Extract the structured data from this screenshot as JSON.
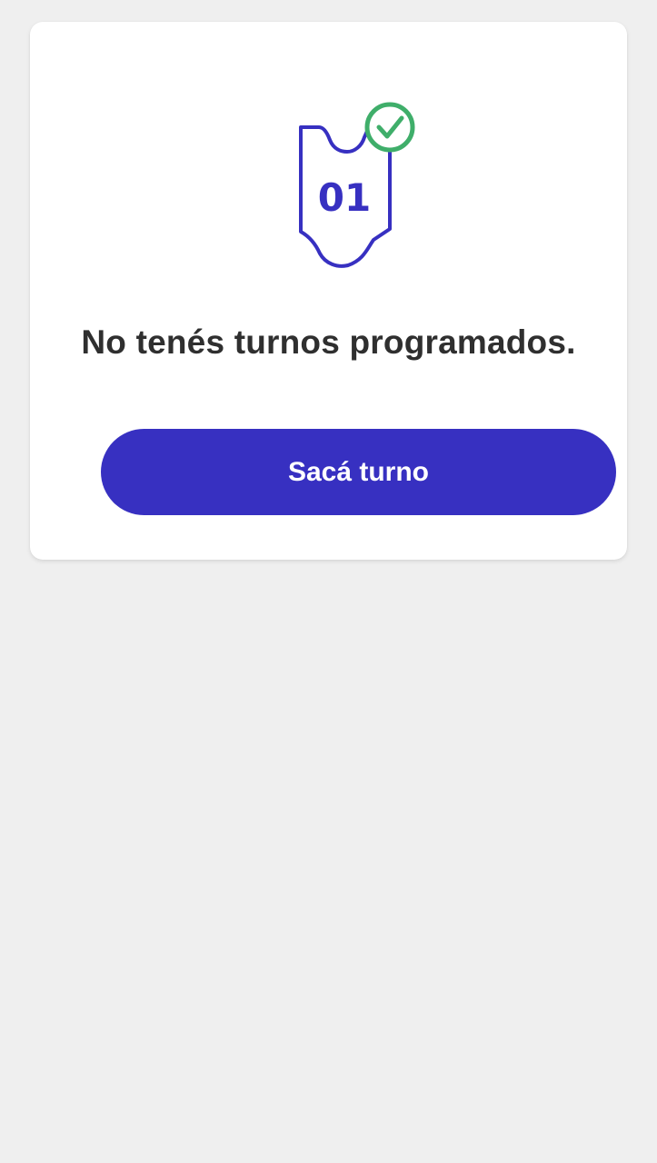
{
  "empty_state": {
    "illustration_icon": "ticket-check-icon",
    "ticket_number": "01",
    "message": "No tenés turnos programados.",
    "cta_label": "Sacá turno"
  },
  "colors": {
    "background": "#efefef",
    "card": "#ffffff",
    "primary": "#3730c1",
    "check": "#3fae6a",
    "text": "#2f2f2f"
  }
}
